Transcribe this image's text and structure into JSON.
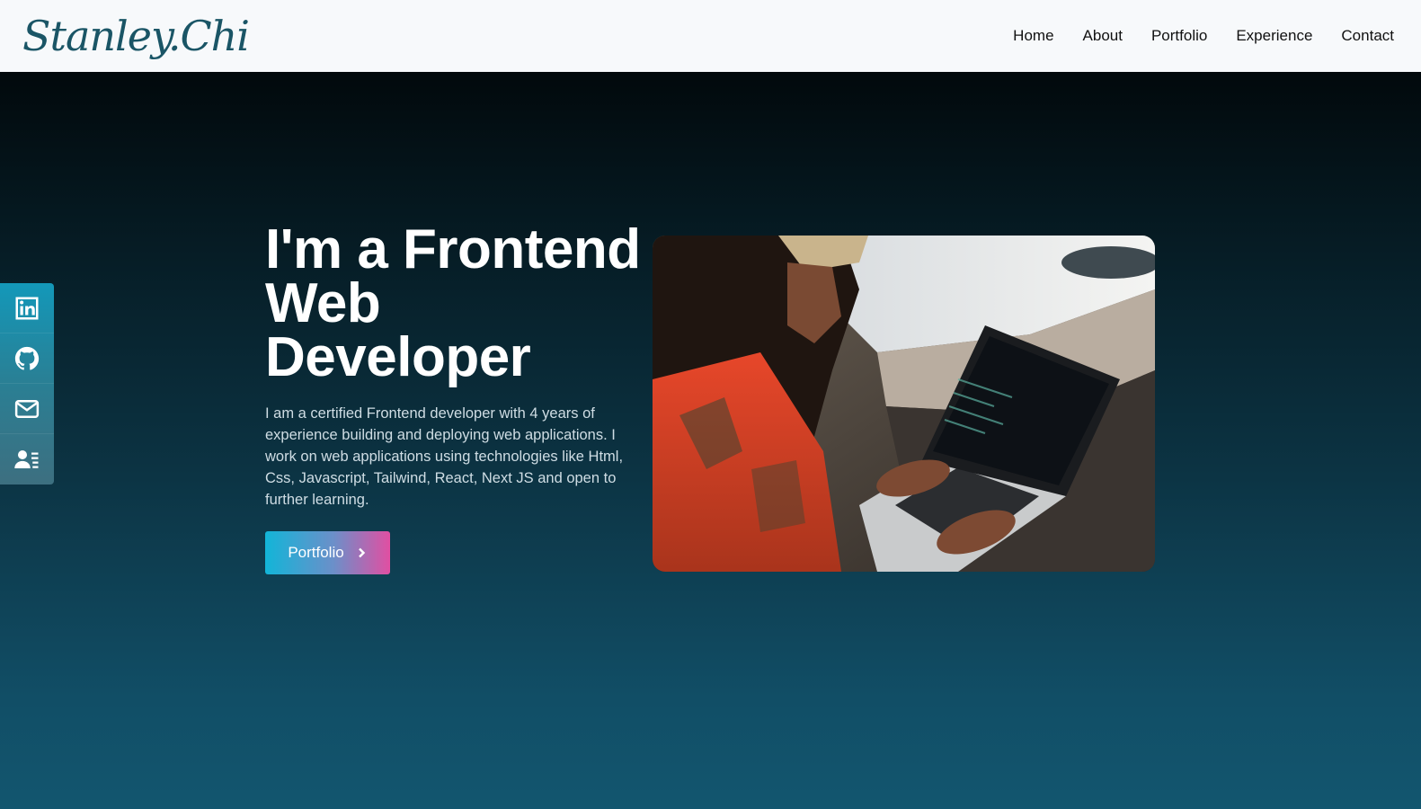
{
  "header": {
    "logo": "Stanley.Chi",
    "nav": [
      {
        "label": "Home"
      },
      {
        "label": "About"
      },
      {
        "label": "Portfolio"
      },
      {
        "label": "Experience"
      },
      {
        "label": "Contact"
      }
    ]
  },
  "social": {
    "icons": [
      "linkedin-icon",
      "github-icon",
      "mail-icon",
      "resume-icon"
    ]
  },
  "hero": {
    "title": "I'm a Frontend Web Developer",
    "description": "I am a certified Frontend developer with 4 years of experience building and deploying web applications. I work on web applications using technologies like Html, Css, Javascript, Tailwind, React, Next JS and open to further learning.",
    "cta_label": "Portfolio",
    "image_alt": "chevron-right-icon"
  },
  "colors": {
    "header_bg": "#f7f9fb",
    "logo": "#1a5566",
    "hero_top": "#02090c",
    "hero_bottom": "#12566f",
    "accent_cyan": "#12b5d8",
    "accent_pink": "#e14fa2"
  }
}
